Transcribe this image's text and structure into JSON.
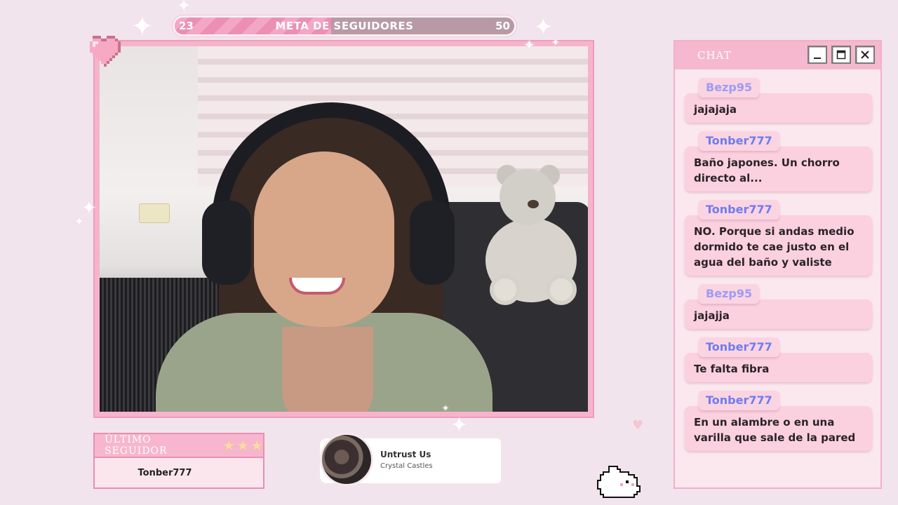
{
  "goal": {
    "current": "23",
    "target": "50",
    "title": "META DE SEGUIDORES",
    "fraction": 0.46
  },
  "last_follower": {
    "title": "ÚLTIMO SEGUIDOR",
    "name": "Tonber777",
    "stars": 3
  },
  "now_playing": {
    "title": "Untrust Us",
    "artist": "Crystal Castles"
  },
  "chat": {
    "title": "CHAT",
    "messages": [
      {
        "user": "Bezp95",
        "text": "jajajaja",
        "color": "#9b9cf5"
      },
      {
        "user": "Tonber777",
        "text": "Baño japones. Un chorro directo al...",
        "color": "#6e7cf0"
      },
      {
        "user": "Tonber777",
        "text": "NO. Porque si andas medio dormido te cae justo en el agua del baño y valiste",
        "color": "#6e7cf0"
      },
      {
        "user": "Bezp95",
        "text": "jajajja",
        "color": "#9b9cf5"
      },
      {
        "user": "Tonber777",
        "text": "Te falta fibra",
        "color": "#6e7cf0"
      },
      {
        "user": "Tonber777",
        "text": "En un alambre o en una varilla que sale de la pared",
        "color": "#6e7cf0"
      }
    ]
  },
  "icons": {
    "heart": "pixel-heart-icon",
    "minimize": "minimize-icon",
    "maximize": "maximize-icon",
    "close": "close-icon",
    "bunny": "pixel-bunny-icon",
    "star": "star-icon",
    "sparkle": "sparkle-icon"
  },
  "colors": {
    "background": "#f2e4ec",
    "frame_pink": "#f5b4cc",
    "accent_pink": "#e98fb3"
  }
}
